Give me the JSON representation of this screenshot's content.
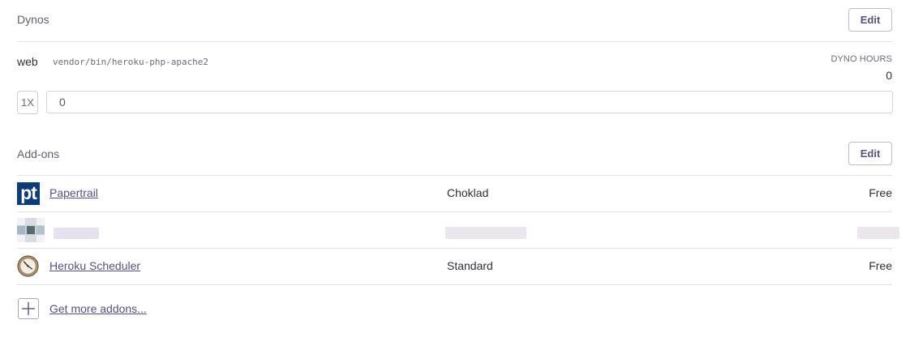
{
  "dynos": {
    "title": "Dynos",
    "edit_label": "Edit",
    "web": {
      "name": "web",
      "command": "vendor/bin/heroku-php-apache2",
      "hours_label": "DYNO HOURS",
      "hours_value": "0",
      "size": "1X",
      "quantity": "0"
    }
  },
  "addons": {
    "title": "Add-ons",
    "edit_label": "Edit",
    "items": [
      {
        "name": "Papertrail",
        "plan": "Choklad",
        "price": "Free",
        "icon": "papertrail-logo",
        "logo_text": "pt"
      },
      {
        "name": "",
        "plan": "",
        "price": "",
        "icon": "blurred-addon-icon"
      },
      {
        "name": "Heroku Scheduler",
        "plan": "Standard",
        "price": "Free",
        "icon": "clock-icon"
      }
    ],
    "more_label": "Get more addons..."
  }
}
